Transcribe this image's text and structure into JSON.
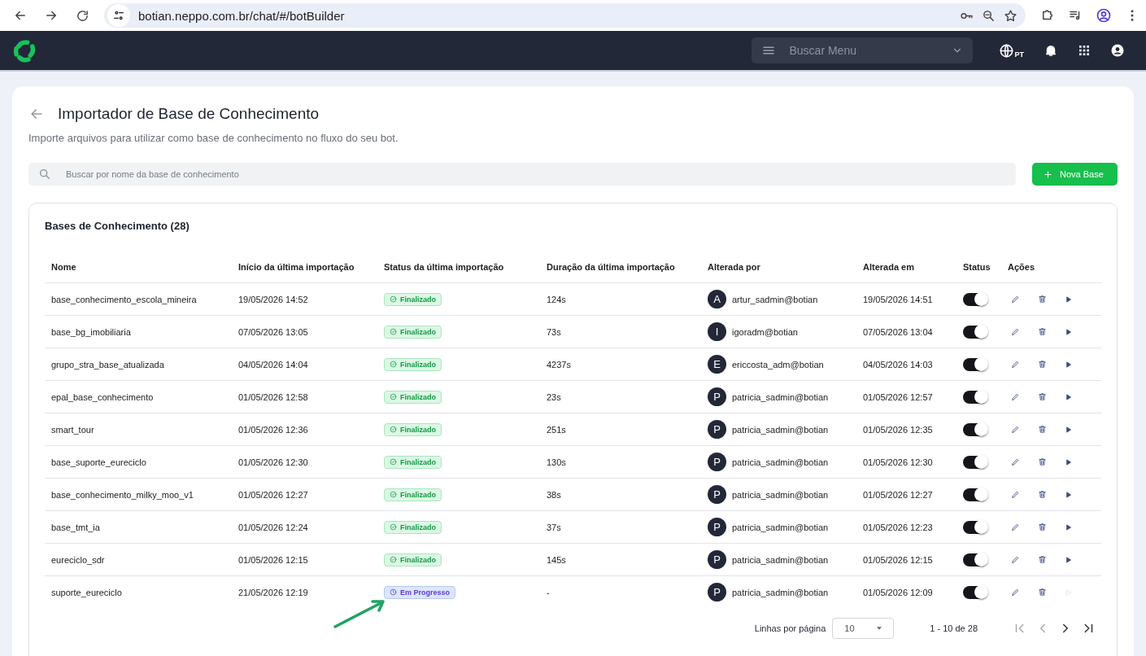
{
  "browser": {
    "url": "botian.neppo.com.br/chat/#/botBuilder"
  },
  "topbar": {
    "menu_search": {
      "placeholder": "Buscar Menu"
    },
    "language": "PT"
  },
  "page": {
    "title": "Importador de Base de Conhecimento",
    "subtitle": "Importe arquivos para utilizar como base de conhecimento no fluxo do seu bot.",
    "search": {
      "placeholder": "Buscar por nome da base de conhecimento"
    },
    "new_button": "Nova Base"
  },
  "table": {
    "title": "Bases de Conhecimento (28)",
    "columns": [
      "Nome",
      "Início da última importação",
      "Status da última importação",
      "Duração da última importação",
      "Alterada por",
      "Alterada em",
      "Status",
      "Ações"
    ],
    "rows": [
      {
        "name": "base_conhecimento_escola_mineira",
        "started": "19/05/2026 14:52",
        "status": {
          "kind": "done",
          "label": "Finalizado"
        },
        "duration": "124s",
        "initial": "A",
        "user": "artur_sadmin@botian",
        "changed": "19/05/2026 14:51",
        "on": true,
        "run_disabled": false
      },
      {
        "name": "base_bg_imobiliaria",
        "started": "07/05/2026 13:05",
        "status": {
          "kind": "done",
          "label": "Finalizado"
        },
        "duration": "73s",
        "initial": "I",
        "user": "igoradm@botian",
        "changed": "07/05/2026 13:04",
        "on": true,
        "run_disabled": false
      },
      {
        "name": "grupo_stra_base_atualizada",
        "started": "04/05/2026 14:04",
        "status": {
          "kind": "done",
          "label": "Finalizado"
        },
        "duration": "4237s",
        "initial": "E",
        "user": "ericcosta_adm@botian",
        "changed": "04/05/2026 14:03",
        "on": true,
        "run_disabled": false
      },
      {
        "name": "epal_base_conhecimento",
        "started": "01/05/2026 12:58",
        "status": {
          "kind": "done",
          "label": "Finalizado"
        },
        "duration": "23s",
        "initial": "P",
        "user": "patricia_sadmin@botian",
        "changed": "01/05/2026 12:57",
        "on": true,
        "run_disabled": false
      },
      {
        "name": "smart_tour",
        "started": "01/05/2026 12:36",
        "status": {
          "kind": "done",
          "label": "Finalizado"
        },
        "duration": "251s",
        "initial": "P",
        "user": "patricia_sadmin@botian",
        "changed": "01/05/2026 12:35",
        "on": true,
        "run_disabled": false
      },
      {
        "name": "base_suporte_eureciclo",
        "started": "01/05/2026 12:30",
        "status": {
          "kind": "done",
          "label": "Finalizado"
        },
        "duration": "130s",
        "initial": "P",
        "user": "patricia_sadmin@botian",
        "changed": "01/05/2026 12:30",
        "on": true,
        "run_disabled": false
      },
      {
        "name": "base_conhecimento_milky_moo_v1",
        "started": "01/05/2026 12:27",
        "status": {
          "kind": "done",
          "label": "Finalizado"
        },
        "duration": "38s",
        "initial": "P",
        "user": "patricia_sadmin@botian",
        "changed": "01/05/2026 12:27",
        "on": true,
        "run_disabled": false
      },
      {
        "name": "base_tmt_ia",
        "started": "01/05/2026 12:24",
        "status": {
          "kind": "done",
          "label": "Finalizado"
        },
        "duration": "37s",
        "initial": "P",
        "user": "patricia_sadmin@botian",
        "changed": "01/05/2026 12:23",
        "on": true,
        "run_disabled": false
      },
      {
        "name": "eureciclo_sdr",
        "started": "01/05/2026 12:15",
        "status": {
          "kind": "done",
          "label": "Finalizado"
        },
        "duration": "145s",
        "initial": "P",
        "user": "patricia_sadmin@botian",
        "changed": "01/05/2026 12:15",
        "on": true,
        "run_disabled": false
      },
      {
        "name": "suporte_eureciclo",
        "started": "21/05/2026 12:19",
        "status": {
          "kind": "progress",
          "label": "Em Progresso"
        },
        "duration": "-",
        "initial": "P",
        "user": "patricia_sadmin@botian",
        "changed": "01/05/2026 12:09",
        "on": true,
        "run_disabled": true
      }
    ]
  },
  "pagination": {
    "label": "Linhas por página",
    "page_size": "10",
    "range": "1 - 10 de 28"
  }
}
